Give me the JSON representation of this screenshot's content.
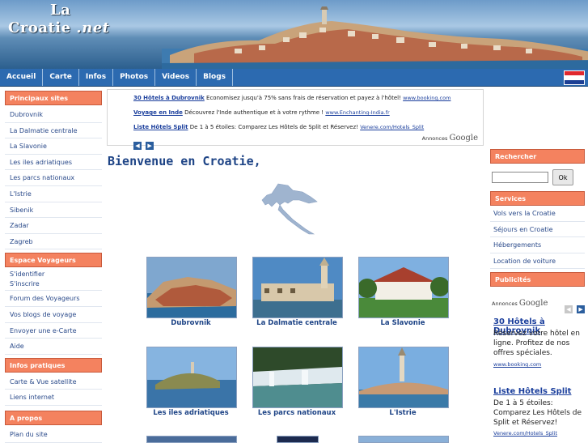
{
  "site": {
    "title_line1": "La",
    "title_line2": "Croatie",
    "title_suffix": ".net"
  },
  "nav": {
    "items": [
      "Accueil",
      "Carte",
      "Infos",
      "Photos",
      "Videos",
      "Blogs"
    ]
  },
  "left_sidebar": {
    "principaux_sites": {
      "heading": "Principaux sites",
      "links": [
        "Dubrovnik",
        "La Dalmatie centrale",
        "La Slavonie",
        "Les iles adriatiques",
        "Les parcs nationaux",
        "L'Istrie",
        "Sibenik",
        "Zadar",
        "Zagreb"
      ]
    },
    "espace_voyageurs": {
      "heading": "Espace Voyageurs",
      "login": "S'identifier",
      "register": "S'inscrire",
      "links": [
        "Forum des Voyageurs",
        "Vos blogs de voyage",
        "Envoyer une e-Carte",
        "Aide"
      ]
    },
    "infos_pratiques": {
      "heading": "Infos pratiques",
      "carte": "Carte &",
      "satellite": "Vue satellite",
      "links": [
        "Liens internet"
      ]
    },
    "a_propos": {
      "heading": "A propos",
      "links": [
        "Plan du site"
      ]
    }
  },
  "ads": {
    "items": [
      {
        "title": "30 Hôtels à Dubrovnik",
        "text": "Economisez jusqu'à 75% sans frais de réservation et payez à l'hôtel!",
        "url": "www.booking.com"
      },
      {
        "title": "Voyage en Inde",
        "text": "Découvrez l'Inde authentique et à votre rythme !",
        "url": "www.Enchanting-India.fr"
      },
      {
        "title": "Liste Hôtels Split",
        "text": "De 1 à 5 étoiles: Comparez Les Hôtels de Split et Réservez!",
        "url": "Venere.com/Hotels_Split"
      }
    ],
    "brand_prefix": "Annonces",
    "brand_name": "Google"
  },
  "main": {
    "welcome": "Bienvenue en Croatie,",
    "gallery": [
      "Dubrovnik",
      "La Dalmatie centrale",
      "La Slavonie",
      "Les iles adriatiques",
      "Les parcs nationaux",
      "L'Istrie"
    ]
  },
  "right_sidebar": {
    "search": {
      "heading": "Rechercher",
      "button": "Ok",
      "value": ""
    },
    "services": {
      "heading": "Services",
      "links": [
        "Vols vers la Croatie",
        "Séjours en Croatie",
        "Hébergements",
        "Location de voiture"
      ]
    },
    "publicites": {
      "heading": "Publicités",
      "brand_prefix": "Annonces",
      "brand_name": "Google",
      "items": [
        {
          "title": "30 Hôtels à Dubrovnik",
          "text": "Réservez votre hôtel en ligne. Profitez de nos offres spéciales.",
          "url": "www.booking.com"
        },
        {
          "title": "Liste Hôtels Split",
          "text": "De 1 à 5 étoiles: Comparez Les Hôtels de Split et Réservez!",
          "url": "Venere.com/Hotels_Split"
        }
      ]
    }
  },
  "colors": {
    "nav": "#2c6ab0",
    "section_header": "#f4825f",
    "link": "#2a4a8a",
    "title_blue": "#1e4486"
  },
  "icons": {
    "flag": "croatia-flag-icon",
    "prev": "chevron-left-icon",
    "next": "chevron-right-icon"
  }
}
